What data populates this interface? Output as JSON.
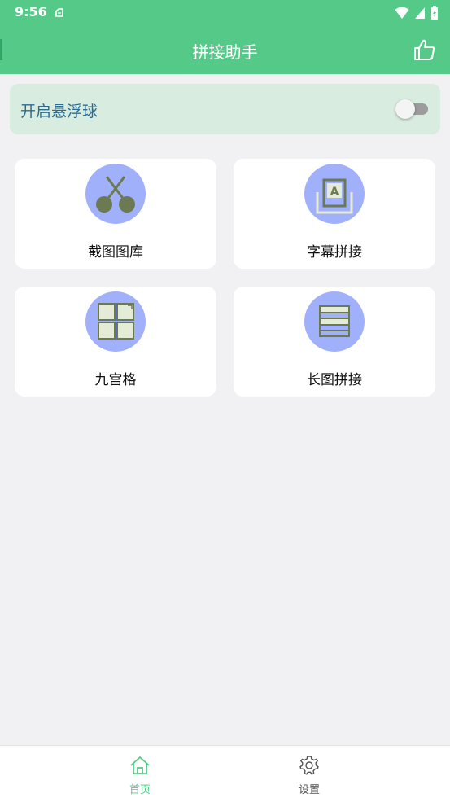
{
  "status_bar": {
    "time": "9:56",
    "icons": [
      "notification-clip-icon",
      "wifi-icon",
      "signal-icon",
      "battery-charging-icon"
    ]
  },
  "app_bar": {
    "title": "拼接助手",
    "action_icon": "thumbs-up-icon"
  },
  "float_ball": {
    "label": "开启悬浮球",
    "enabled": false
  },
  "tiles": [
    {
      "label": "截图图库",
      "icon": "scissors-icon"
    },
    {
      "label": "字幕拼接",
      "icon": "subtitle-a-icon"
    },
    {
      "label": "九宫格",
      "icon": "grid-icon"
    },
    {
      "label": "长图拼接",
      "icon": "stack-icon"
    }
  ],
  "bottom_nav": {
    "items": [
      {
        "label": "首页",
        "icon": "home-icon",
        "active": true
      },
      {
        "label": "设置",
        "icon": "gear-icon",
        "active": false
      }
    ]
  },
  "colors": {
    "primary": "#55c987",
    "tile_icon_bg": "#a1b0fb",
    "icon_fill": "#6b7a52",
    "toggle_label": "#2b6b8f",
    "nav_active": "#55c987",
    "nav_inactive": "#555555"
  }
}
